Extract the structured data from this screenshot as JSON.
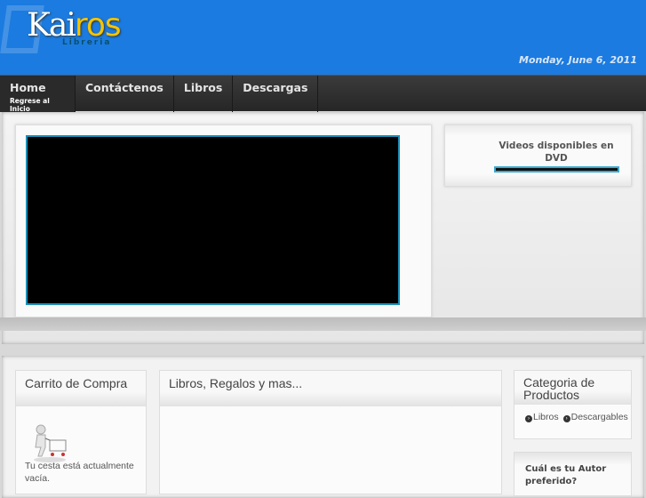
{
  "header": {
    "logo_main": "Kai",
    "logo_accent": "ros",
    "logo_sub": "Libreria",
    "date": "Monday, June 6, 2011"
  },
  "nav": [
    {
      "label": "Home",
      "sub": "Regrese al Inicio"
    },
    {
      "label": "Contáctenos"
    },
    {
      "label": "Libros"
    },
    {
      "label": "Descargas"
    }
  ],
  "featured": {
    "dvd_title": "Videos disponibles en DVD"
  },
  "cart": {
    "title": "Carrito de Compra",
    "empty_text": "Tu cesta está actualmente vacía."
  },
  "main": {
    "title": "Libros, Regalos y mas..."
  },
  "categories": {
    "title": "Categoria de Productos",
    "links": [
      "Libros",
      "Descargables"
    ]
  },
  "poll": {
    "question": "Cuál es tu Autor preferido?"
  },
  "colors": {
    "header": "#1b7be0",
    "accent": "#f5c400",
    "nav": "#333333"
  }
}
